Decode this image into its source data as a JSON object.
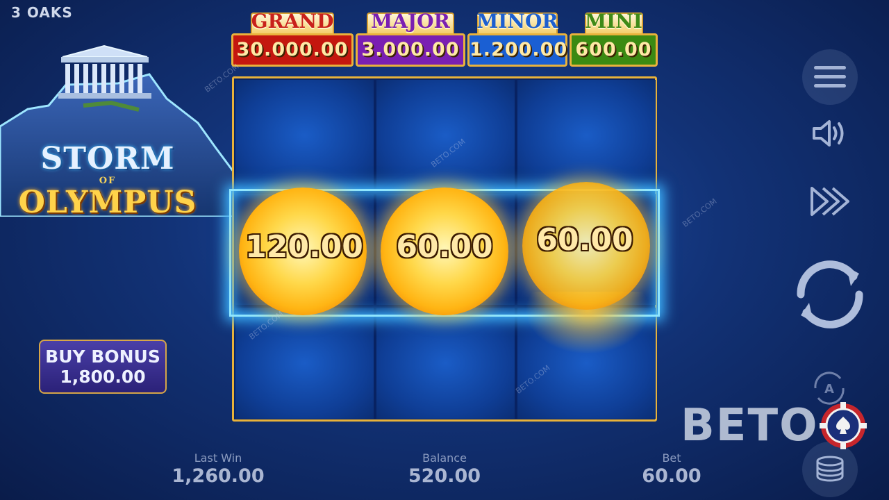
{
  "brand": "3 OAKS",
  "logo": {
    "line1": "STORM",
    "line2": "OF",
    "line3": "OLYMPUS"
  },
  "jackpots": [
    {
      "name": "GRAND",
      "value": "30.000.00",
      "name_color": "#c8211b",
      "box_color": "#c4170f"
    },
    {
      "name": "MAJOR",
      "value": "3.000.00",
      "name_color": "#7a1fb2",
      "box_color": "#7a1fb2"
    },
    {
      "name": "MINOR",
      "value": "1.200.00",
      "name_color": "#1c5fd0",
      "box_color": "#1a5fd3"
    },
    {
      "name": "MINI",
      "value": "600.00",
      "name_color": "#3f8a17",
      "box_color": "#3b8a12"
    }
  ],
  "orbs": [
    {
      "value": "120.00"
    },
    {
      "value": "60.00"
    },
    {
      "value": "60.00"
    }
  ],
  "buy_bonus": {
    "label": "BUY BONUS",
    "price": "1,800.00"
  },
  "stats": {
    "last_win": {
      "label": "Last Win",
      "value": "1,260.00"
    },
    "balance": {
      "label": "Balance",
      "value": "520.00"
    },
    "bet": {
      "label": "Bet",
      "value": "60.00"
    }
  },
  "auto_letter": "A",
  "watermark": {
    "text": "BETO.COM",
    "logo": "BETO"
  },
  "colors": {
    "frame_gold": "#e8b23a",
    "lightning": "#3fb6ff",
    "orb": "#ffc72c"
  }
}
